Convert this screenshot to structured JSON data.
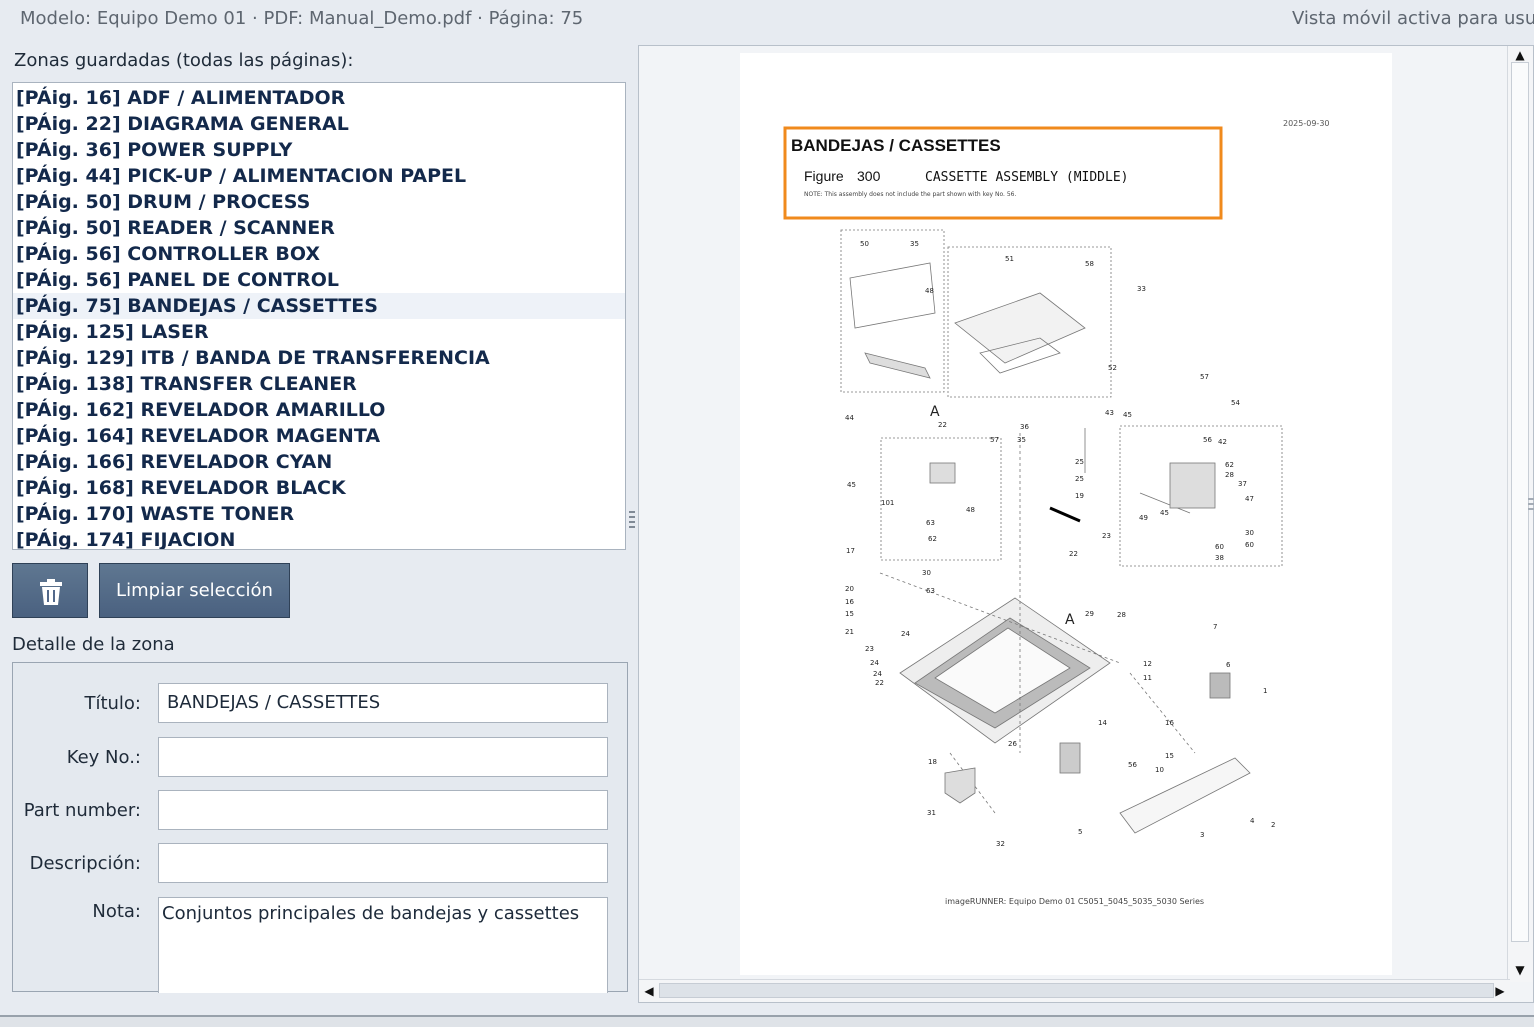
{
  "header": {
    "info": "Modelo: Equipo Demo 01 · PDF: Manual_Demo.pdf · Página: 75",
    "mobile_notice": "Vista móvil activa para usurr"
  },
  "zones": {
    "label": "Zonas guardadas (todas las páginas):",
    "selected_index": 8,
    "items": [
      "[PÁig. 16] ADF / ALIMENTADOR",
      "[PÁig. 22] DIAGRAMA GENERAL",
      "[PÁig. 36] POWER SUPPLY",
      "[PÁig. 44] PICK-UP / ALIMENTACION PAPEL",
      "[PÁig. 50] DRUM / PROCESS",
      "[PÁig. 50] READER / SCANNER",
      "[PÁig. 56] CONTROLLER BOX",
      "[PÁig. 56] PANEL DE CONTROL",
      "[PÁig. 75] BANDEJAS / CASSETTES",
      "[PÁig. 125] LASER",
      "[PÁig. 129] ITB / BANDA DE TRANSFERENCIA",
      "[PÁig. 138] TRANSFER CLEANER",
      "[PÁig. 162] REVELADOR AMARILLO",
      "[PÁig. 164] REVELADOR MAGENTA",
      "[PÁig. 166] REVELADOR CYAN",
      "[PÁig. 168] REVELADOR BLACK",
      "[PÁig. 170] WASTE TONER",
      "[PÁig. 174] FIJACION"
    ]
  },
  "buttons": {
    "trash_icon": "trash-icon",
    "clear": "Limpiar selección"
  },
  "detail": {
    "section_label": "Detalle de la zona",
    "title_label": "Título:",
    "title_value": "BANDEJAS / CASSETTES",
    "key_label": "Key No.:",
    "key_value": "",
    "part_label": "Part number:",
    "part_value": "",
    "desc_label": "Descripción:",
    "desc_value": "",
    "note_label": "Nota:",
    "note_value": "Conjuntos principales de bandejas y cassettes"
  },
  "pdf_page": {
    "date": "2025-09-30",
    "highlight_title": "BANDEJAS / CASSETTES",
    "highlight_color": "#f08a1c",
    "figure_label": "Figure",
    "figure_number": "300",
    "figure_title": "CASSETTE ASSEMBLY (MIDDLE)",
    "note": "NOTE:  This assembly does not include the part shown with key No. 56.",
    "footer": "imageRUNNER: Equipo Demo 01 C5051_5045_5035_5030 Series",
    "labels": [
      "50",
      "35",
      "48",
      "44",
      "51",
      "58",
      "33",
      "52",
      "57",
      "43",
      "45",
      "A",
      "22",
      "36",
      "35",
      "25",
      "25",
      "19",
      "54",
      "56",
      "42",
      "62",
      "28",
      "37",
      "47",
      "49",
      "45",
      "60",
      "30",
      "38",
      "60",
      "57",
      "45",
      "101",
      "48",
      "63",
      "62",
      "17",
      "30",
      "63",
      "23",
      "22",
      "20",
      "16",
      "15",
      "21",
      "24",
      "23",
      "24",
      "24",
      "22",
      "A",
      "29",
      "28",
      "7",
      "6",
      "12",
      "11",
      "1",
      "14",
      "16",
      "10",
      "56",
      "15",
      "18",
      "26",
      "31",
      "32",
      "5",
      "3",
      "4",
      "2"
    ]
  },
  "scroll": {
    "up": "▲",
    "down": "▼",
    "left": "◀",
    "right": "▶"
  }
}
